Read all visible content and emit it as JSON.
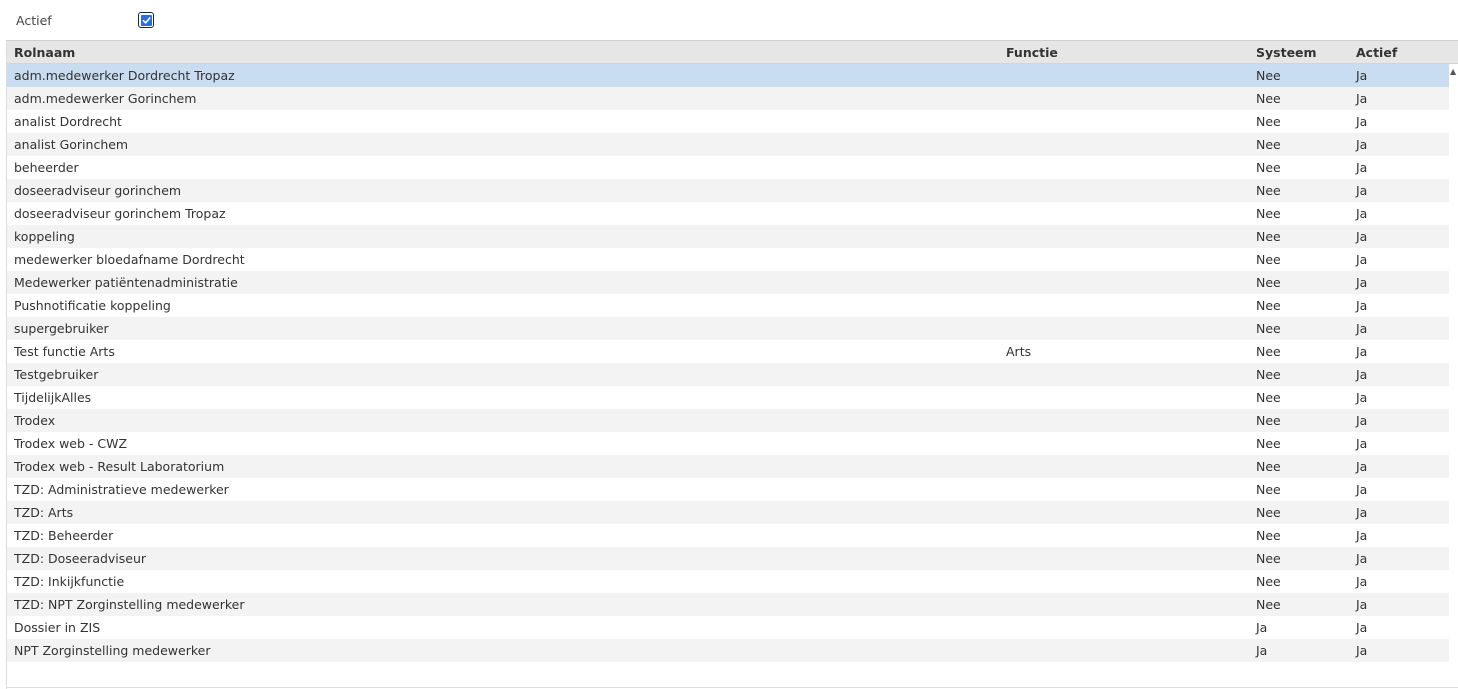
{
  "filter": {
    "label": "Actief",
    "checked": true
  },
  "columns": {
    "rolnaam": "Rolnaam",
    "functie": "Functie",
    "systeem": "Systeem",
    "actief": "Actief"
  },
  "selected_row": 0,
  "rows": [
    {
      "rolnaam": "adm.medewerker Dordrecht Tropaz",
      "functie": "",
      "systeem": "Nee",
      "actief": "Ja"
    },
    {
      "rolnaam": "adm.medewerker Gorinchem",
      "functie": "",
      "systeem": "Nee",
      "actief": "Ja"
    },
    {
      "rolnaam": "analist Dordrecht",
      "functie": "",
      "systeem": "Nee",
      "actief": "Ja"
    },
    {
      "rolnaam": "analist Gorinchem",
      "functie": "",
      "systeem": "Nee",
      "actief": "Ja"
    },
    {
      "rolnaam": "beheerder",
      "functie": "",
      "systeem": "Nee",
      "actief": "Ja"
    },
    {
      "rolnaam": "doseeradviseur gorinchem",
      "functie": "",
      "systeem": "Nee",
      "actief": "Ja"
    },
    {
      "rolnaam": "doseeradviseur gorinchem Tropaz",
      "functie": "",
      "systeem": "Nee",
      "actief": "Ja"
    },
    {
      "rolnaam": "koppeling",
      "functie": "",
      "systeem": "Nee",
      "actief": "Ja"
    },
    {
      "rolnaam": "medewerker bloedafname Dordrecht",
      "functie": "",
      "systeem": "Nee",
      "actief": "Ja"
    },
    {
      "rolnaam": "Medewerker patiëntenadministratie",
      "functie": "",
      "systeem": "Nee",
      "actief": "Ja"
    },
    {
      "rolnaam": "Pushnotificatie koppeling",
      "functie": "",
      "systeem": "Nee",
      "actief": "Ja"
    },
    {
      "rolnaam": "supergebruiker",
      "functie": "",
      "systeem": "Nee",
      "actief": "Ja"
    },
    {
      "rolnaam": "Test functie Arts",
      "functie": "Arts",
      "systeem": "Nee",
      "actief": "Ja"
    },
    {
      "rolnaam": "Testgebruiker",
      "functie": "",
      "systeem": "Nee",
      "actief": "Ja"
    },
    {
      "rolnaam": "TijdelijkAlles",
      "functie": "",
      "systeem": "Nee",
      "actief": "Ja"
    },
    {
      "rolnaam": "Trodex",
      "functie": "",
      "systeem": "Nee",
      "actief": "Ja"
    },
    {
      "rolnaam": "Trodex web - CWZ",
      "functie": "",
      "systeem": "Nee",
      "actief": "Ja"
    },
    {
      "rolnaam": "Trodex web - Result Laboratorium",
      "functie": "",
      "systeem": "Nee",
      "actief": "Ja"
    },
    {
      "rolnaam": "TZD: Administratieve medewerker",
      "functie": "",
      "systeem": "Nee",
      "actief": "Ja"
    },
    {
      "rolnaam": "TZD: Arts",
      "functie": "",
      "systeem": "Nee",
      "actief": "Ja"
    },
    {
      "rolnaam": "TZD: Beheerder",
      "functie": "",
      "systeem": "Nee",
      "actief": "Ja"
    },
    {
      "rolnaam": "TZD: Doseeradviseur",
      "functie": "",
      "systeem": "Nee",
      "actief": "Ja"
    },
    {
      "rolnaam": "TZD: Inkijkfunctie",
      "functie": "",
      "systeem": "Nee",
      "actief": "Ja"
    },
    {
      "rolnaam": "TZD: NPT Zorginstelling medewerker",
      "functie": "",
      "systeem": "Nee",
      "actief": "Ja"
    },
    {
      "rolnaam": "Dossier in ZIS",
      "functie": "",
      "systeem": "Ja",
      "actief": "Ja"
    },
    {
      "rolnaam": "NPT Zorginstelling medewerker",
      "functie": "",
      "systeem": "Ja",
      "actief": "Ja"
    }
  ],
  "icons": {
    "checkbox": "checkmark-icon",
    "scroll_up": "caret-up-icon"
  },
  "colors": {
    "selected_row": "#c8dcf2",
    "checkbox_fill": "#2e6fd6"
  }
}
